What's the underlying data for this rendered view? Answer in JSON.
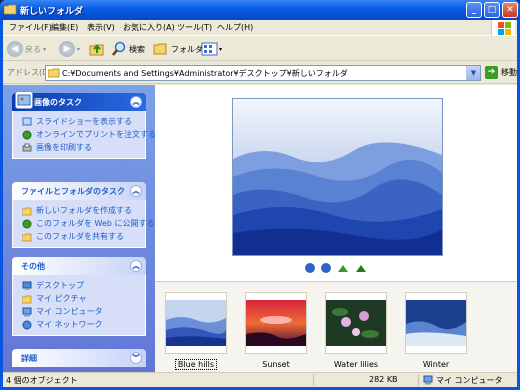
{
  "window": {
    "title": "新しいフォルダ"
  },
  "menubar": [
    "ファイル(F)",
    "編集(E)",
    "表示(V)",
    "お気に入り(A)",
    "ツール(T)",
    "ヘルプ(H)"
  ],
  "toolbar": {
    "back": "戻る",
    "search": "検索",
    "folders": "フォルダ"
  },
  "address": {
    "label": "アドレス(D)",
    "value": "C:¥Documents and Settings¥Administrator¥デスクトップ¥新しいフォルダ",
    "go": "移動"
  },
  "taskpane": {
    "picture_tasks": {
      "title": "画像のタスク",
      "items": [
        "スライドショーを表示する",
        "オンラインでプリントを注文する",
        "画像を印刷する"
      ]
    },
    "file_tasks": {
      "title": "ファイルとフォルダのタスク",
      "items": [
        "新しいフォルダを作成する",
        "このフォルダを Web に公開する",
        "このフォルダを共有する"
      ]
    },
    "other_places": {
      "title": "その他",
      "items": [
        "デスクトップ",
        "マイ ピクチャ",
        "マイ コンピュータ",
        "マイ ネットワーク"
      ]
    },
    "details": {
      "title": "詳細"
    }
  },
  "thumbnails": [
    {
      "name": "Blue hills",
      "selected": true
    },
    {
      "name": "Sunset",
      "selected": false
    },
    {
      "name": "Water lilies",
      "selected": false
    },
    {
      "name": "Winter",
      "selected": false
    }
  ],
  "status": {
    "count": "4 個のオブジェクト",
    "size": "282 KB",
    "location": "マイ コンピュータ"
  },
  "colors": {
    "titlebar": "#0a5fe2",
    "taskpane": "#7ba2e7",
    "link": "#215dc6"
  }
}
